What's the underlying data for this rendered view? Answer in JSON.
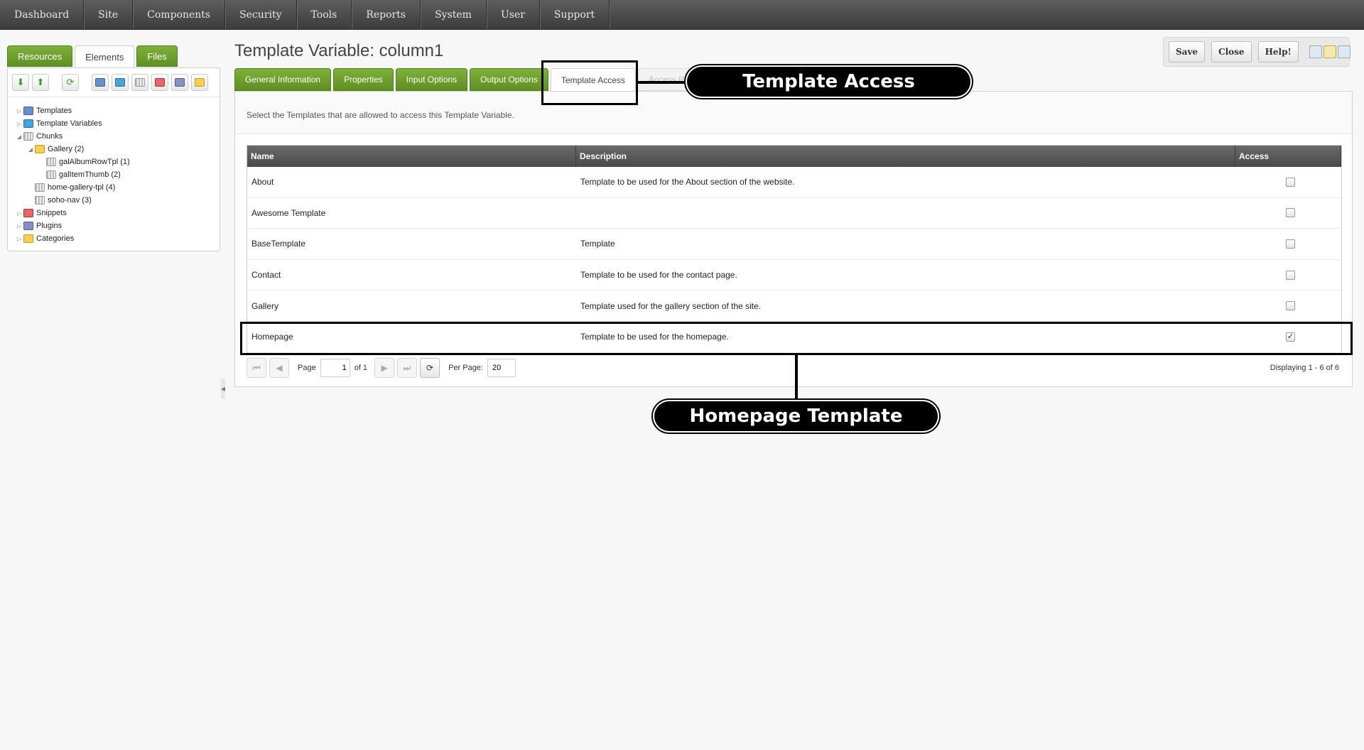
{
  "topnav": {
    "items": [
      "Dashboard",
      "Site",
      "Components",
      "Security",
      "Tools",
      "Reports",
      "System",
      "User",
      "Support"
    ]
  },
  "left": {
    "tabs": [
      "Resources",
      "Elements",
      "Files"
    ],
    "active_tab": "Elements",
    "toolbar_icons": [
      "arrow-down-icon",
      "arrow-up-icon",
      "refresh-icon",
      "new-template-icon",
      "new-tv-icon",
      "new-chunk-icon",
      "new-snippet-icon",
      "new-plugin-icon",
      "new-category-icon"
    ],
    "tree": [
      {
        "label": "Templates",
        "icon": "template-icon",
        "toggle": "▷"
      },
      {
        "label": "Template Variables",
        "icon": "tv-icon",
        "toggle": "▷"
      },
      {
        "label": "Chunks",
        "icon": "chunk-icon",
        "toggle": "◢"
      },
      {
        "label": "Gallery (2)",
        "icon": "folder-icon",
        "toggle": "◢"
      },
      {
        "label": "galAlbumRowTpl (1)",
        "icon": "chunk-icon",
        "toggle": ""
      },
      {
        "label": "galItemThumb (2)",
        "icon": "chunk-icon",
        "toggle": ""
      },
      {
        "label": "home-gallery-tpl (4)",
        "icon": "chunk-icon",
        "toggle": ""
      },
      {
        "label": "soho-nav (3)",
        "icon": "chunk-icon",
        "toggle": ""
      },
      {
        "label": "Snippets",
        "icon": "snippet-icon",
        "toggle": "▷"
      },
      {
        "label": "Plugins",
        "icon": "plugin-icon",
        "toggle": "▷"
      },
      {
        "label": "Categories",
        "icon": "folder-icon",
        "toggle": "▷"
      }
    ]
  },
  "page": {
    "title": "Template Variable: column1"
  },
  "actions": {
    "save": "Save",
    "close": "Close",
    "help": "Help!"
  },
  "tabs": [
    "General Information",
    "Properties",
    "Input Options",
    "Output Options",
    "Template Access",
    "Access Pe"
  ],
  "active_tab": "Template Access",
  "panel": {
    "description": "Select the Templates that are allowed to access this Template Variable."
  },
  "grid": {
    "columns": [
      "Name",
      "Description",
      "Access"
    ],
    "rows": [
      {
        "name": "About",
        "description": "Template to be used for the About section of the website.",
        "access": ""
      },
      {
        "name": "Awesome Template",
        "description": "",
        "access": ""
      },
      {
        "name": "BaseTemplate",
        "description": "Template",
        "access": ""
      },
      {
        "name": "Contact",
        "description": "Template to be used for the contact page.",
        "access": ""
      },
      {
        "name": "Gallery",
        "description": "Template used for the gallery section of the site.",
        "access": ""
      },
      {
        "name": "Homepage",
        "description": "Template to be used for the homepage.",
        "access": "✓"
      }
    ]
  },
  "pager": {
    "page_label": "Page",
    "page_value": "1",
    "of_label": "of 1",
    "per_page_label": "Per Page:",
    "per_page_value": "20",
    "display_text": "Displaying 1 - 6 of 6"
  },
  "callouts": {
    "template_access": "Template Access",
    "homepage_template": "Homepage Template"
  }
}
